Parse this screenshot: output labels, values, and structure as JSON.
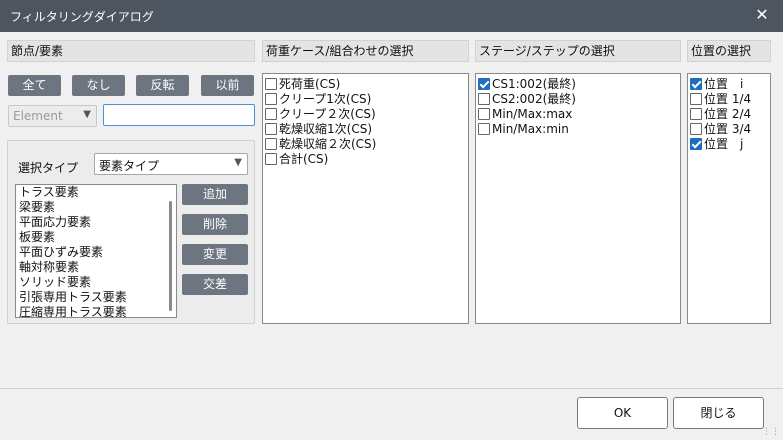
{
  "window": {
    "title": "フィルタリングダイアログ",
    "close_glyph": "✕"
  },
  "nodes": {
    "header": "節点/要素",
    "buttons": {
      "all": "全て",
      "none": "なし",
      "invert": "反転",
      "previous": "以前"
    },
    "type_combo": {
      "value": "Element"
    },
    "text_input": {
      "value": ""
    },
    "select_type": {
      "label": "選択タイプ",
      "value": "要素タイプ",
      "items": [
        "トラス要素",
        "梁要素",
        "平面応力要素",
        "板要素",
        "平面ひずみ要素",
        "軸対称要素",
        "ソリッド要素",
        "引張専用トラス要素",
        "圧縮専用トラス要素"
      ],
      "buttons": {
        "add": "追加",
        "remove": "削除",
        "change": "変更",
        "intersect": "交差"
      }
    }
  },
  "load_cases": {
    "header": "荷重ケース/組合わせの選択",
    "items": [
      {
        "label": "死荷重(CS)",
        "checked": false
      },
      {
        "label": "クリープ1次(CS)",
        "checked": false
      },
      {
        "label": "クリープ２次(CS)",
        "checked": false
      },
      {
        "label": "乾燥収縮1次(CS)",
        "checked": false
      },
      {
        "label": "乾燥収縮２次(CS)",
        "checked": false
      },
      {
        "label": "合計(CS)",
        "checked": false
      }
    ]
  },
  "stages": {
    "header": "ステージ/ステップの選択",
    "items": [
      {
        "label": "CS1:002(最終)",
        "checked": true
      },
      {
        "label": "CS2:002(最終)",
        "checked": false
      },
      {
        "label": "Min/Max:max",
        "checked": false
      },
      {
        "label": "Min/Max:min",
        "checked": false
      }
    ]
  },
  "positions": {
    "header": "位置の選択",
    "items": [
      {
        "label": "位置　i",
        "checked": true
      },
      {
        "label": "位置 1/4",
        "checked": false
      },
      {
        "label": "位置 2/4",
        "checked": false
      },
      {
        "label": "位置 3/4",
        "checked": false
      },
      {
        "label": "位置　j",
        "checked": true
      }
    ]
  },
  "footer": {
    "ok": "OK",
    "close": "閉じる"
  }
}
